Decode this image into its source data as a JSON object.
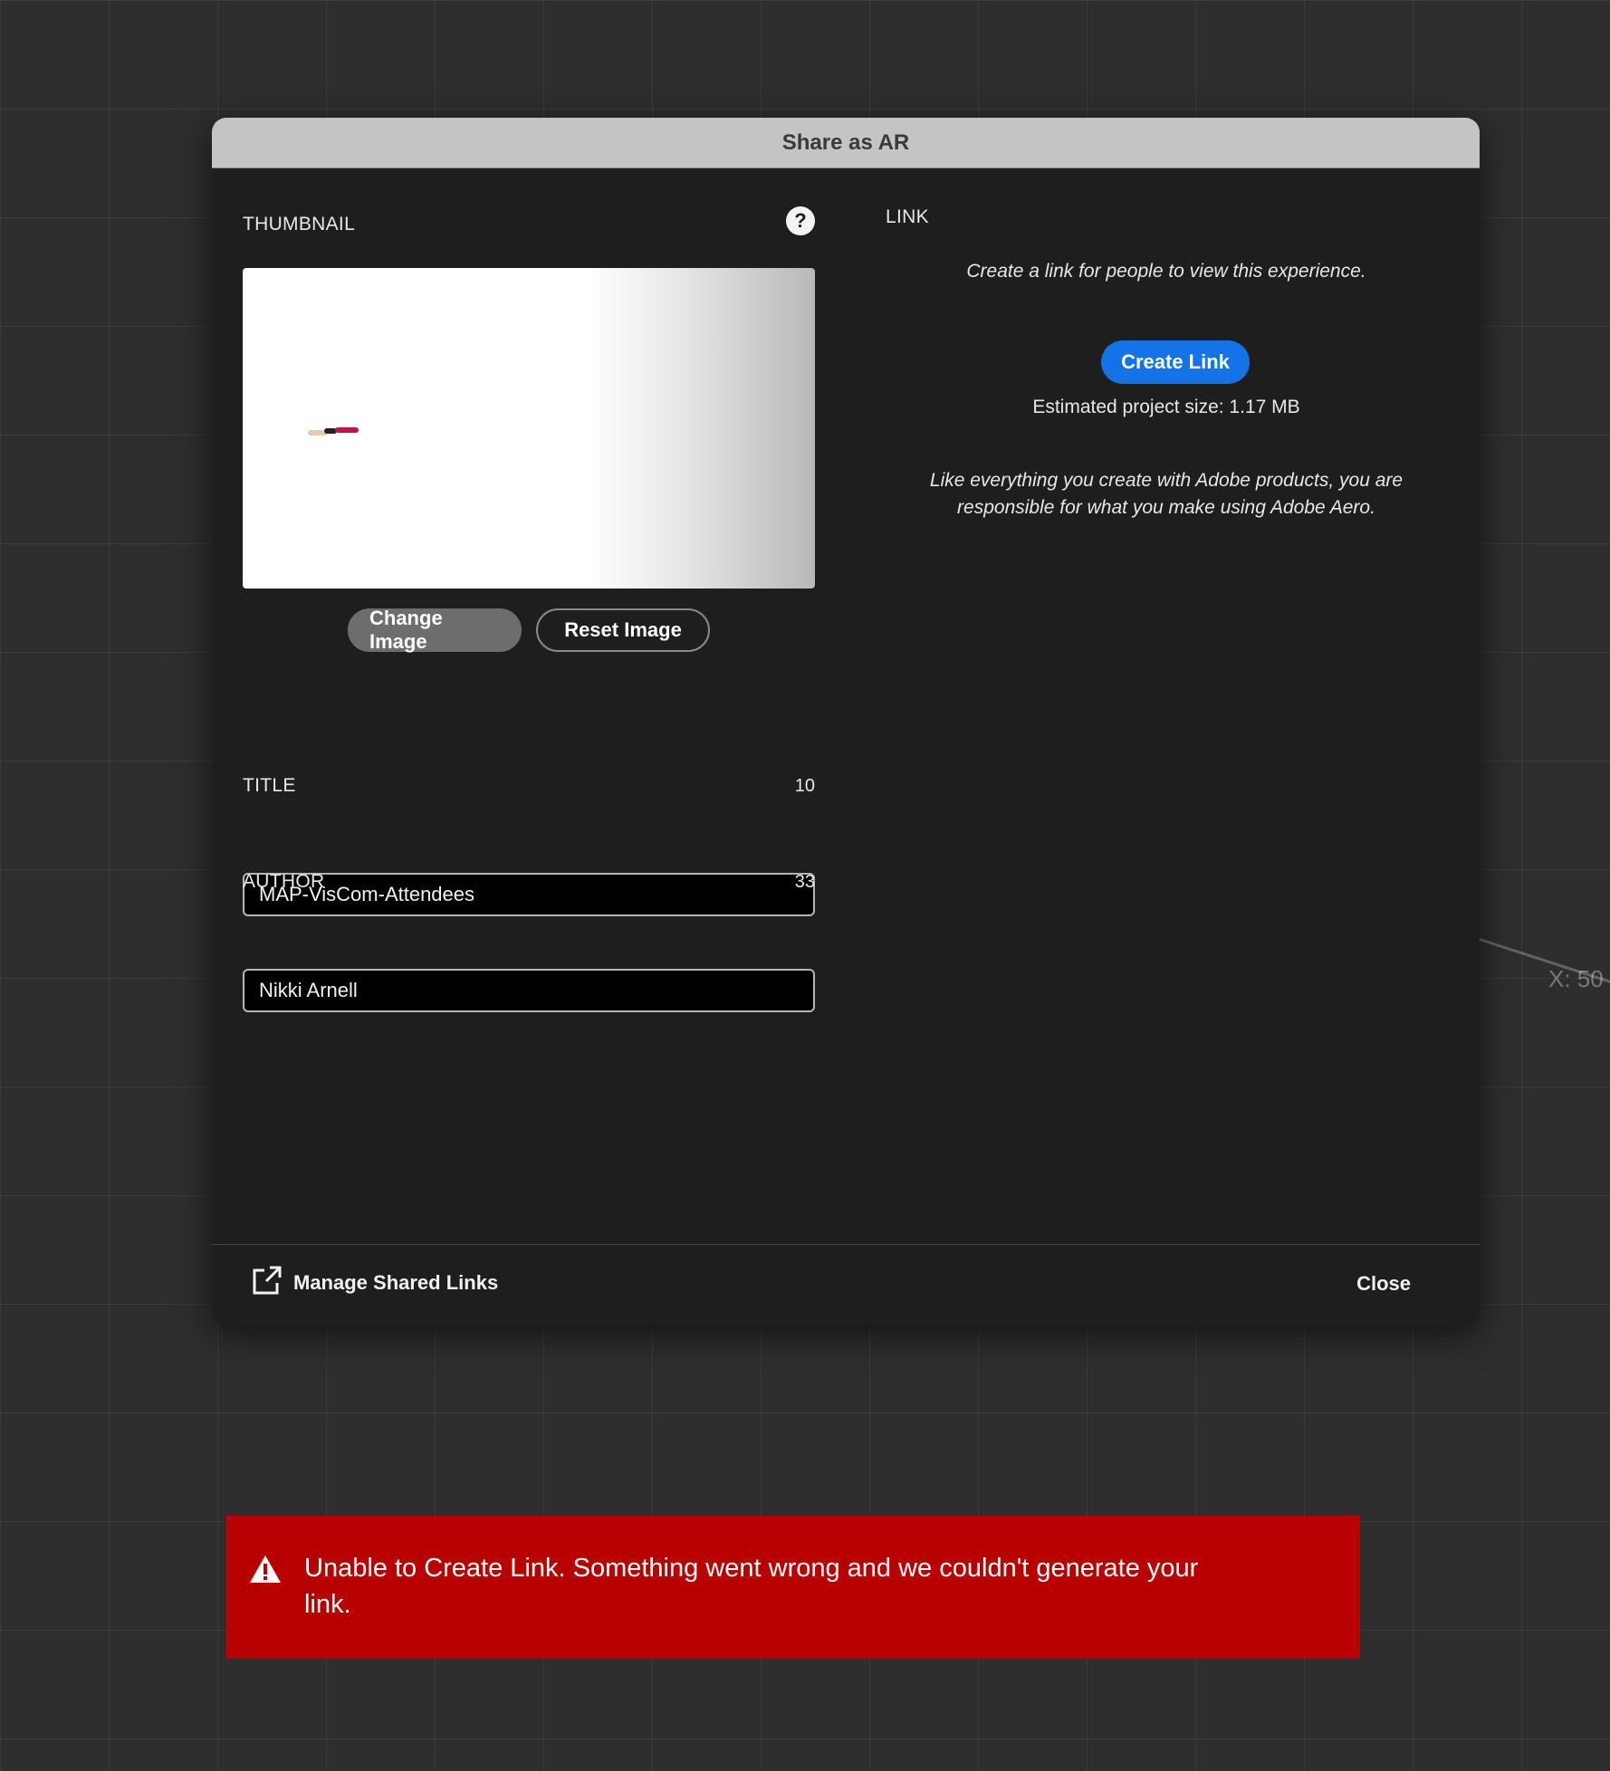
{
  "dialog": {
    "title": "Share as AR"
  },
  "thumbnail": {
    "label": "THUMBNAIL",
    "help_icon": "help-icon",
    "change_label": "Change Image",
    "reset_label": "Reset Image"
  },
  "fields": {
    "title_label": "TITLE",
    "title_count": "10",
    "title_value": "MAP-VisCom-Attendees",
    "author_label": "AUTHOR",
    "author_count": "33",
    "author_value": "Nikki Arnell"
  },
  "link": {
    "label": "LINK",
    "description": "Create a link for people to view this experience.",
    "create_label": "Create Link",
    "estimated_size": "Estimated project size:  1.17 MB",
    "disclaimer": "Like everything you create with Adobe products, you are responsible for what you make using Adobe Aero.",
    "accent_color": "#1473e6"
  },
  "footer": {
    "manage_label": "Manage Shared Links",
    "manage_icon": "external-link-icon",
    "close_label": "Close"
  },
  "viewport": {
    "axis_readout": "X: 50"
  },
  "toast": {
    "icon": "warning-icon",
    "message": "Unable to Create Link. Something went wrong and we couldn't generate your link.",
    "color": "#b90000"
  }
}
